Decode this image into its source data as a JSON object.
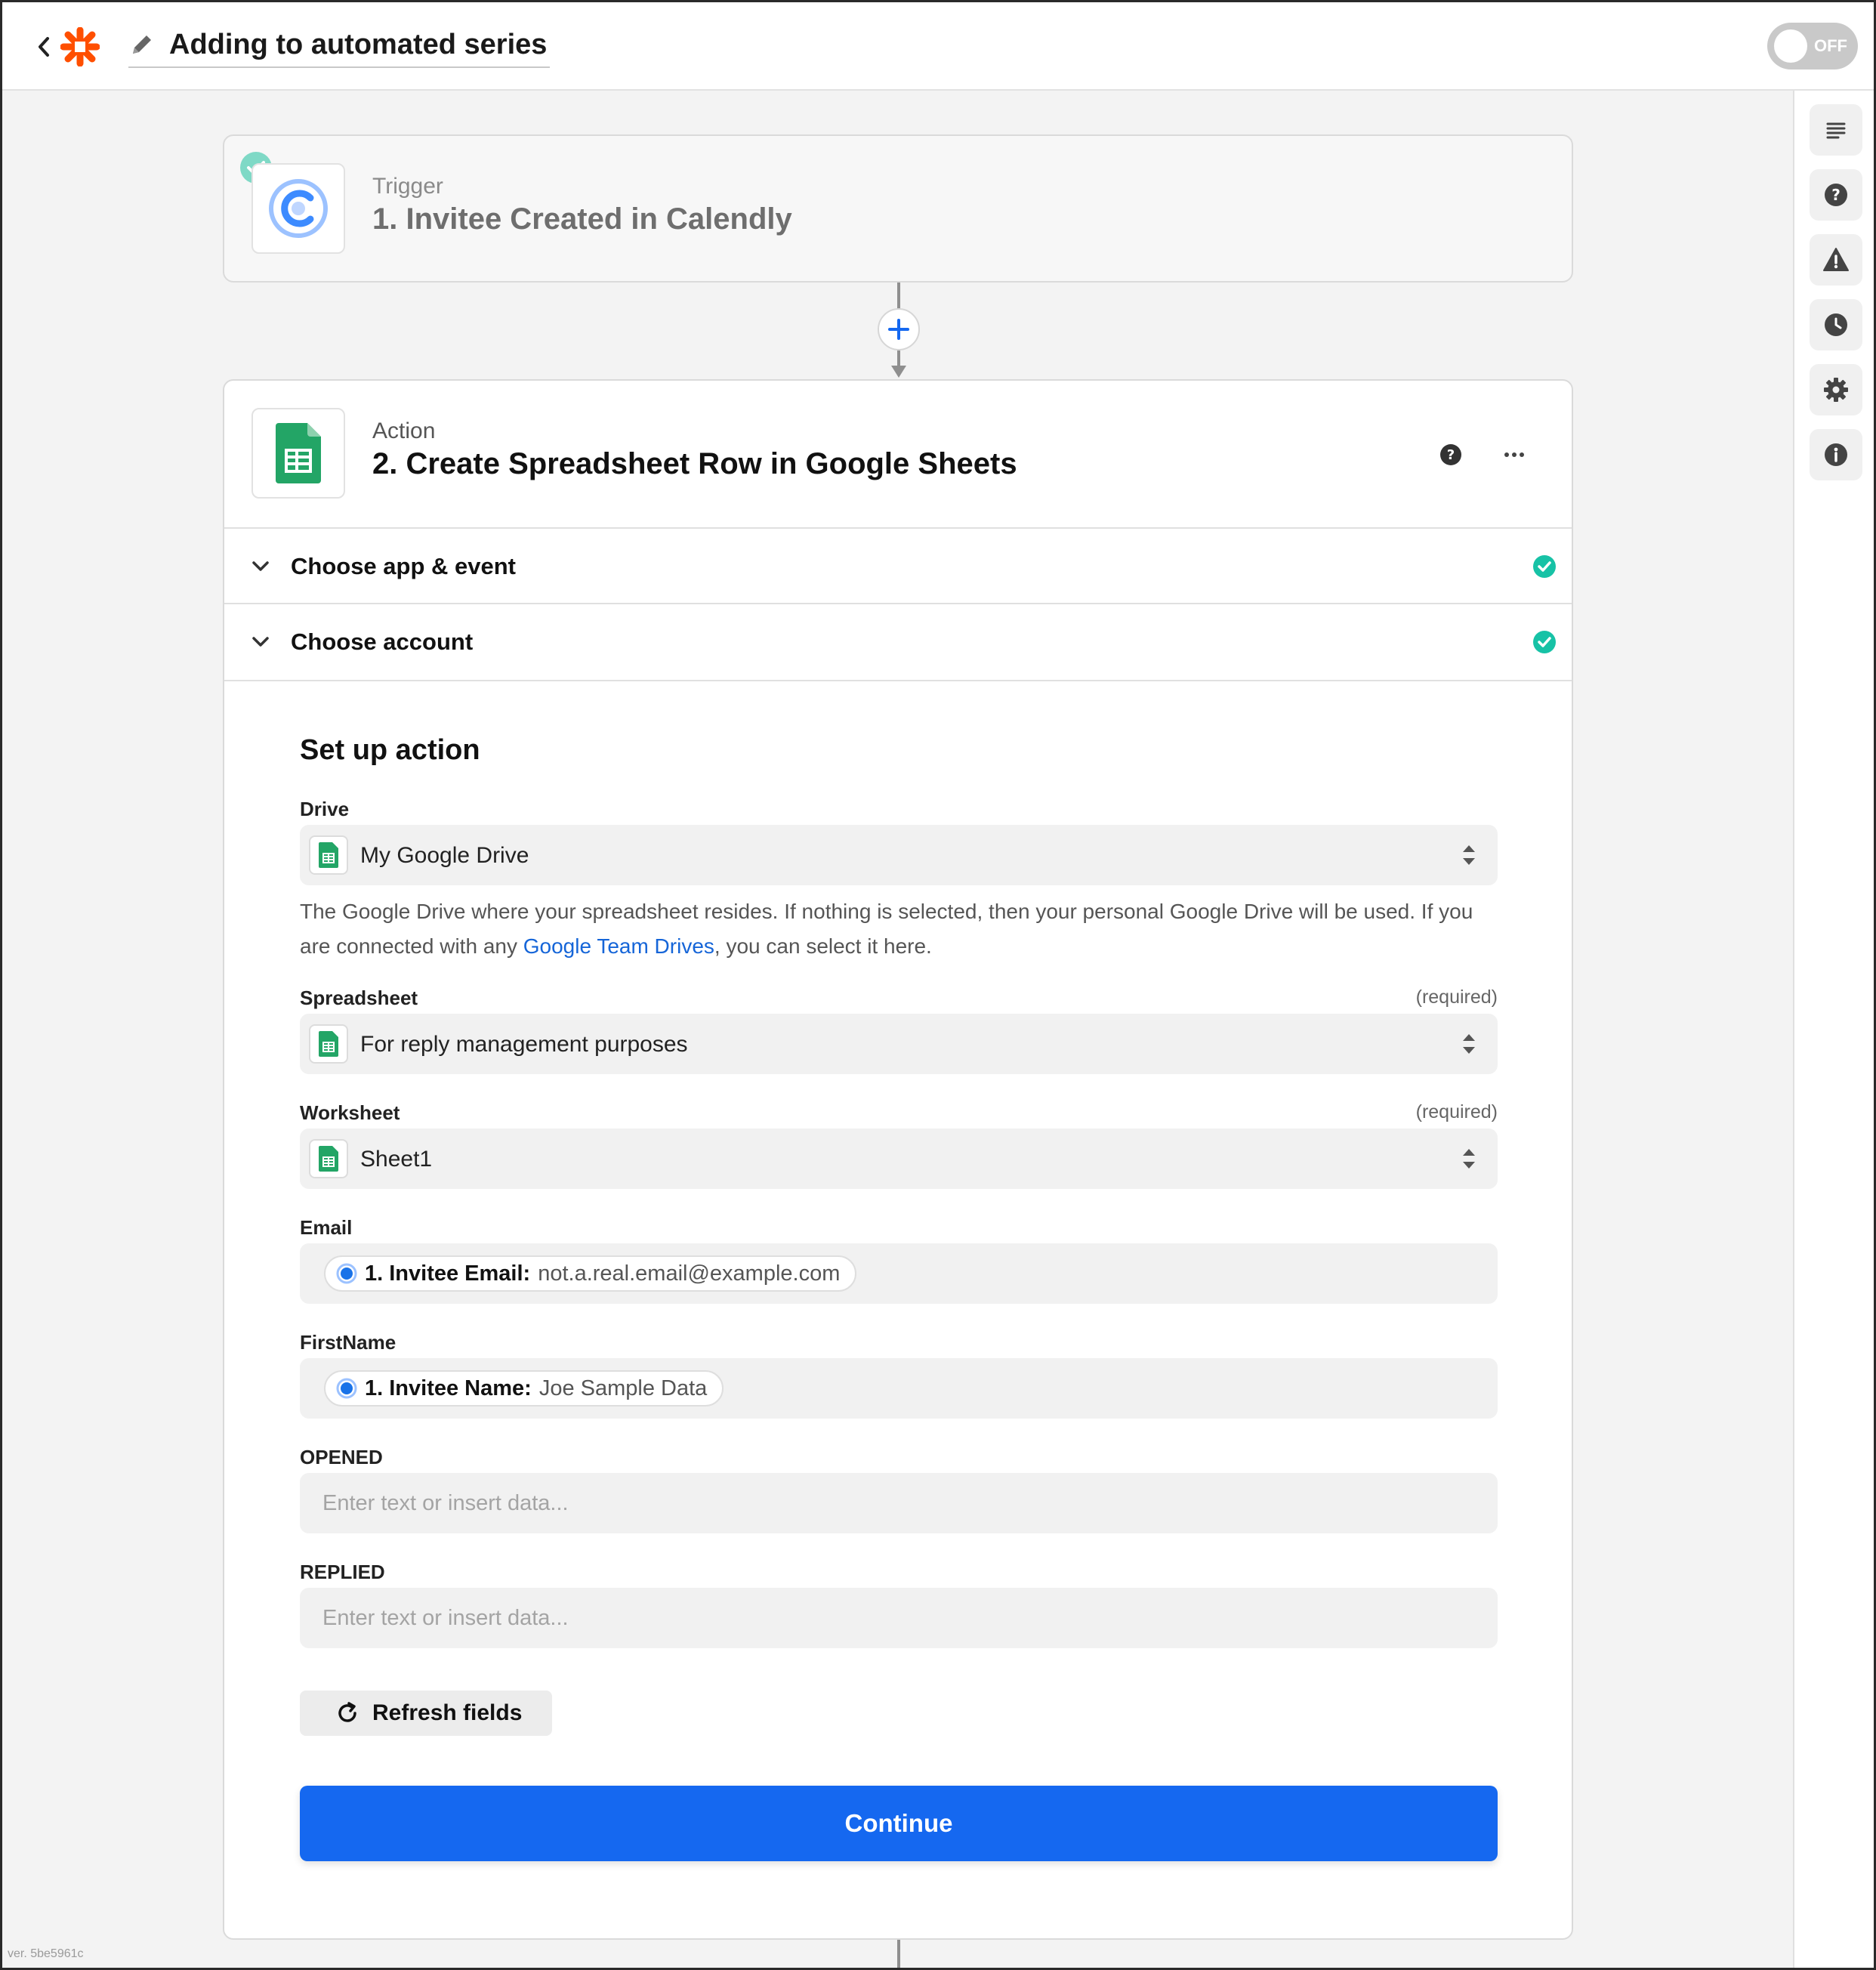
{
  "header": {
    "title": "Adding to automated series",
    "toggle_label": "OFF"
  },
  "trigger": {
    "kind": "Trigger",
    "name": "1. Invitee Created in Calendly"
  },
  "action": {
    "kind": "Action",
    "name": "2. Create Spreadsheet Row in Google Sheets",
    "sections": [
      {
        "label": "Choose app & event"
      },
      {
        "label": "Choose account"
      }
    ]
  },
  "setup": {
    "title": "Set up action",
    "drive": {
      "label": "Drive",
      "value": "My Google Drive",
      "help_before": "The Google Drive where your spreadsheet resides. If nothing is selected, then your personal Google Drive will be used. If you are connected with any ",
      "help_link": "Google Team Drives",
      "help_after": ", you can select it here."
    },
    "spreadsheet": {
      "label": "Spreadsheet",
      "required": "(required)",
      "value": "For reply management purposes"
    },
    "worksheet": {
      "label": "Worksheet",
      "required": "(required)",
      "value": "Sheet1"
    },
    "email": {
      "label": "Email",
      "pill_key": "1. Invitee Email:",
      "pill_value": "not.a.real.email@example.com"
    },
    "firstname": {
      "label": "FirstName",
      "pill_key": "1. Invitee Name:",
      "pill_value": "Joe Sample Data"
    },
    "opened": {
      "label": "OPENED",
      "placeholder": "Enter text or insert data..."
    },
    "replied": {
      "label": "REPLIED",
      "placeholder": "Enter text or insert data..."
    },
    "refresh_label": "Refresh fields",
    "continue_label": "Continue"
  },
  "footer": {
    "version": "ver. 5be5961c"
  },
  "colors": {
    "accent": "#1568f0",
    "zapier_orange": "#ff4f00",
    "success": "#17c2a6",
    "sheets_green": "#23a566",
    "calendly_blue": "#3d8bff"
  }
}
